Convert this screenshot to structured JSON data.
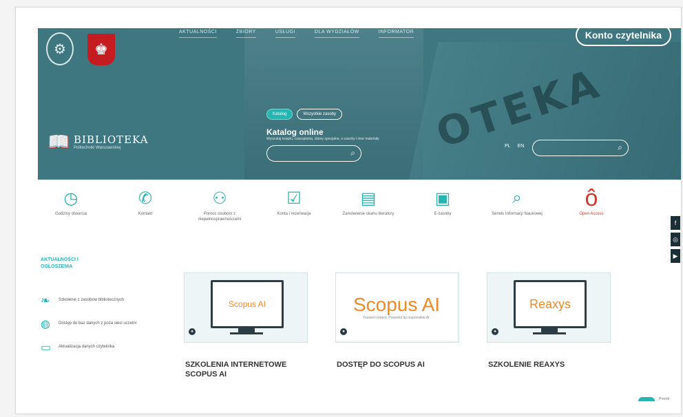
{
  "header": {
    "nav": [
      "AKTUALNOŚCI",
      "ZBIORY",
      "USŁUGI",
      "DLA WYDZIAŁÓW",
      "INFORMATOR"
    ],
    "konto": "Konto czytelnika",
    "logo_title": "BIBLIOTEKA",
    "logo_sub": "Politechniki Warszawskiej",
    "pill_active": "Katalog",
    "pill_other": "Wszystkie zasoby",
    "katalog_title": "Katalog online",
    "katalog_sub": "Wyszukaj książki, czasopisma, zbiory specjalne, e-zasoby i inne materiały",
    "lang_pl": "PL",
    "lang_en": "EN",
    "hero_text": "OTEKA"
  },
  "tiles": [
    {
      "icon": "clock-icon",
      "glyph": "◷",
      "label": "Godziny otwarcia"
    },
    {
      "icon": "phone-icon",
      "glyph": "✆",
      "label": "Kontakt"
    },
    {
      "icon": "people-icon",
      "glyph": "⚇",
      "label": "Pomoc osobom z niepełnosprawnościami"
    },
    {
      "icon": "check-icon",
      "glyph": "☑",
      "label": "Konta i rezerwacje"
    },
    {
      "icon": "document-icon",
      "glyph": "▤",
      "label": "Zamówienie skanu literatury"
    },
    {
      "icon": "book-icon",
      "glyph": "▣",
      "label": "E-zasoby"
    },
    {
      "icon": "search-doc-icon",
      "glyph": "⌕",
      "label": "Serwis Informacji Naukowej"
    },
    {
      "icon": "open-access-icon",
      "glyph": "ô",
      "label": "Open Access"
    }
  ],
  "news": {
    "heading": "AKTUALNOŚCI I OGŁOSZENIA",
    "items": [
      {
        "icon": "leaf-icon",
        "glyph": "❧",
        "text": "Szkolenie z zasobów bibliotecznych"
      },
      {
        "icon": "globe-icon",
        "glyph": "◍",
        "text": "Dostęp do baz danych z poza sieci uczelni"
      },
      {
        "icon": "card-icon",
        "glyph": "▭",
        "text": "Aktualizacja danych czytelnika"
      }
    ]
  },
  "cards": [
    {
      "brand": "Scopus AI",
      "title": "SZKOLENIA INTERNETOWE SCOPUS AI"
    },
    {
      "brand": "Scopus AI",
      "sub": "Trusted content. Powered by responsible AI.",
      "title": "DOSTĘP DO SCOPUS AI"
    },
    {
      "brand": "Reaxys",
      "title": "SZKOLENIE REAXYS"
    }
  ],
  "footer": "Powrót"
}
